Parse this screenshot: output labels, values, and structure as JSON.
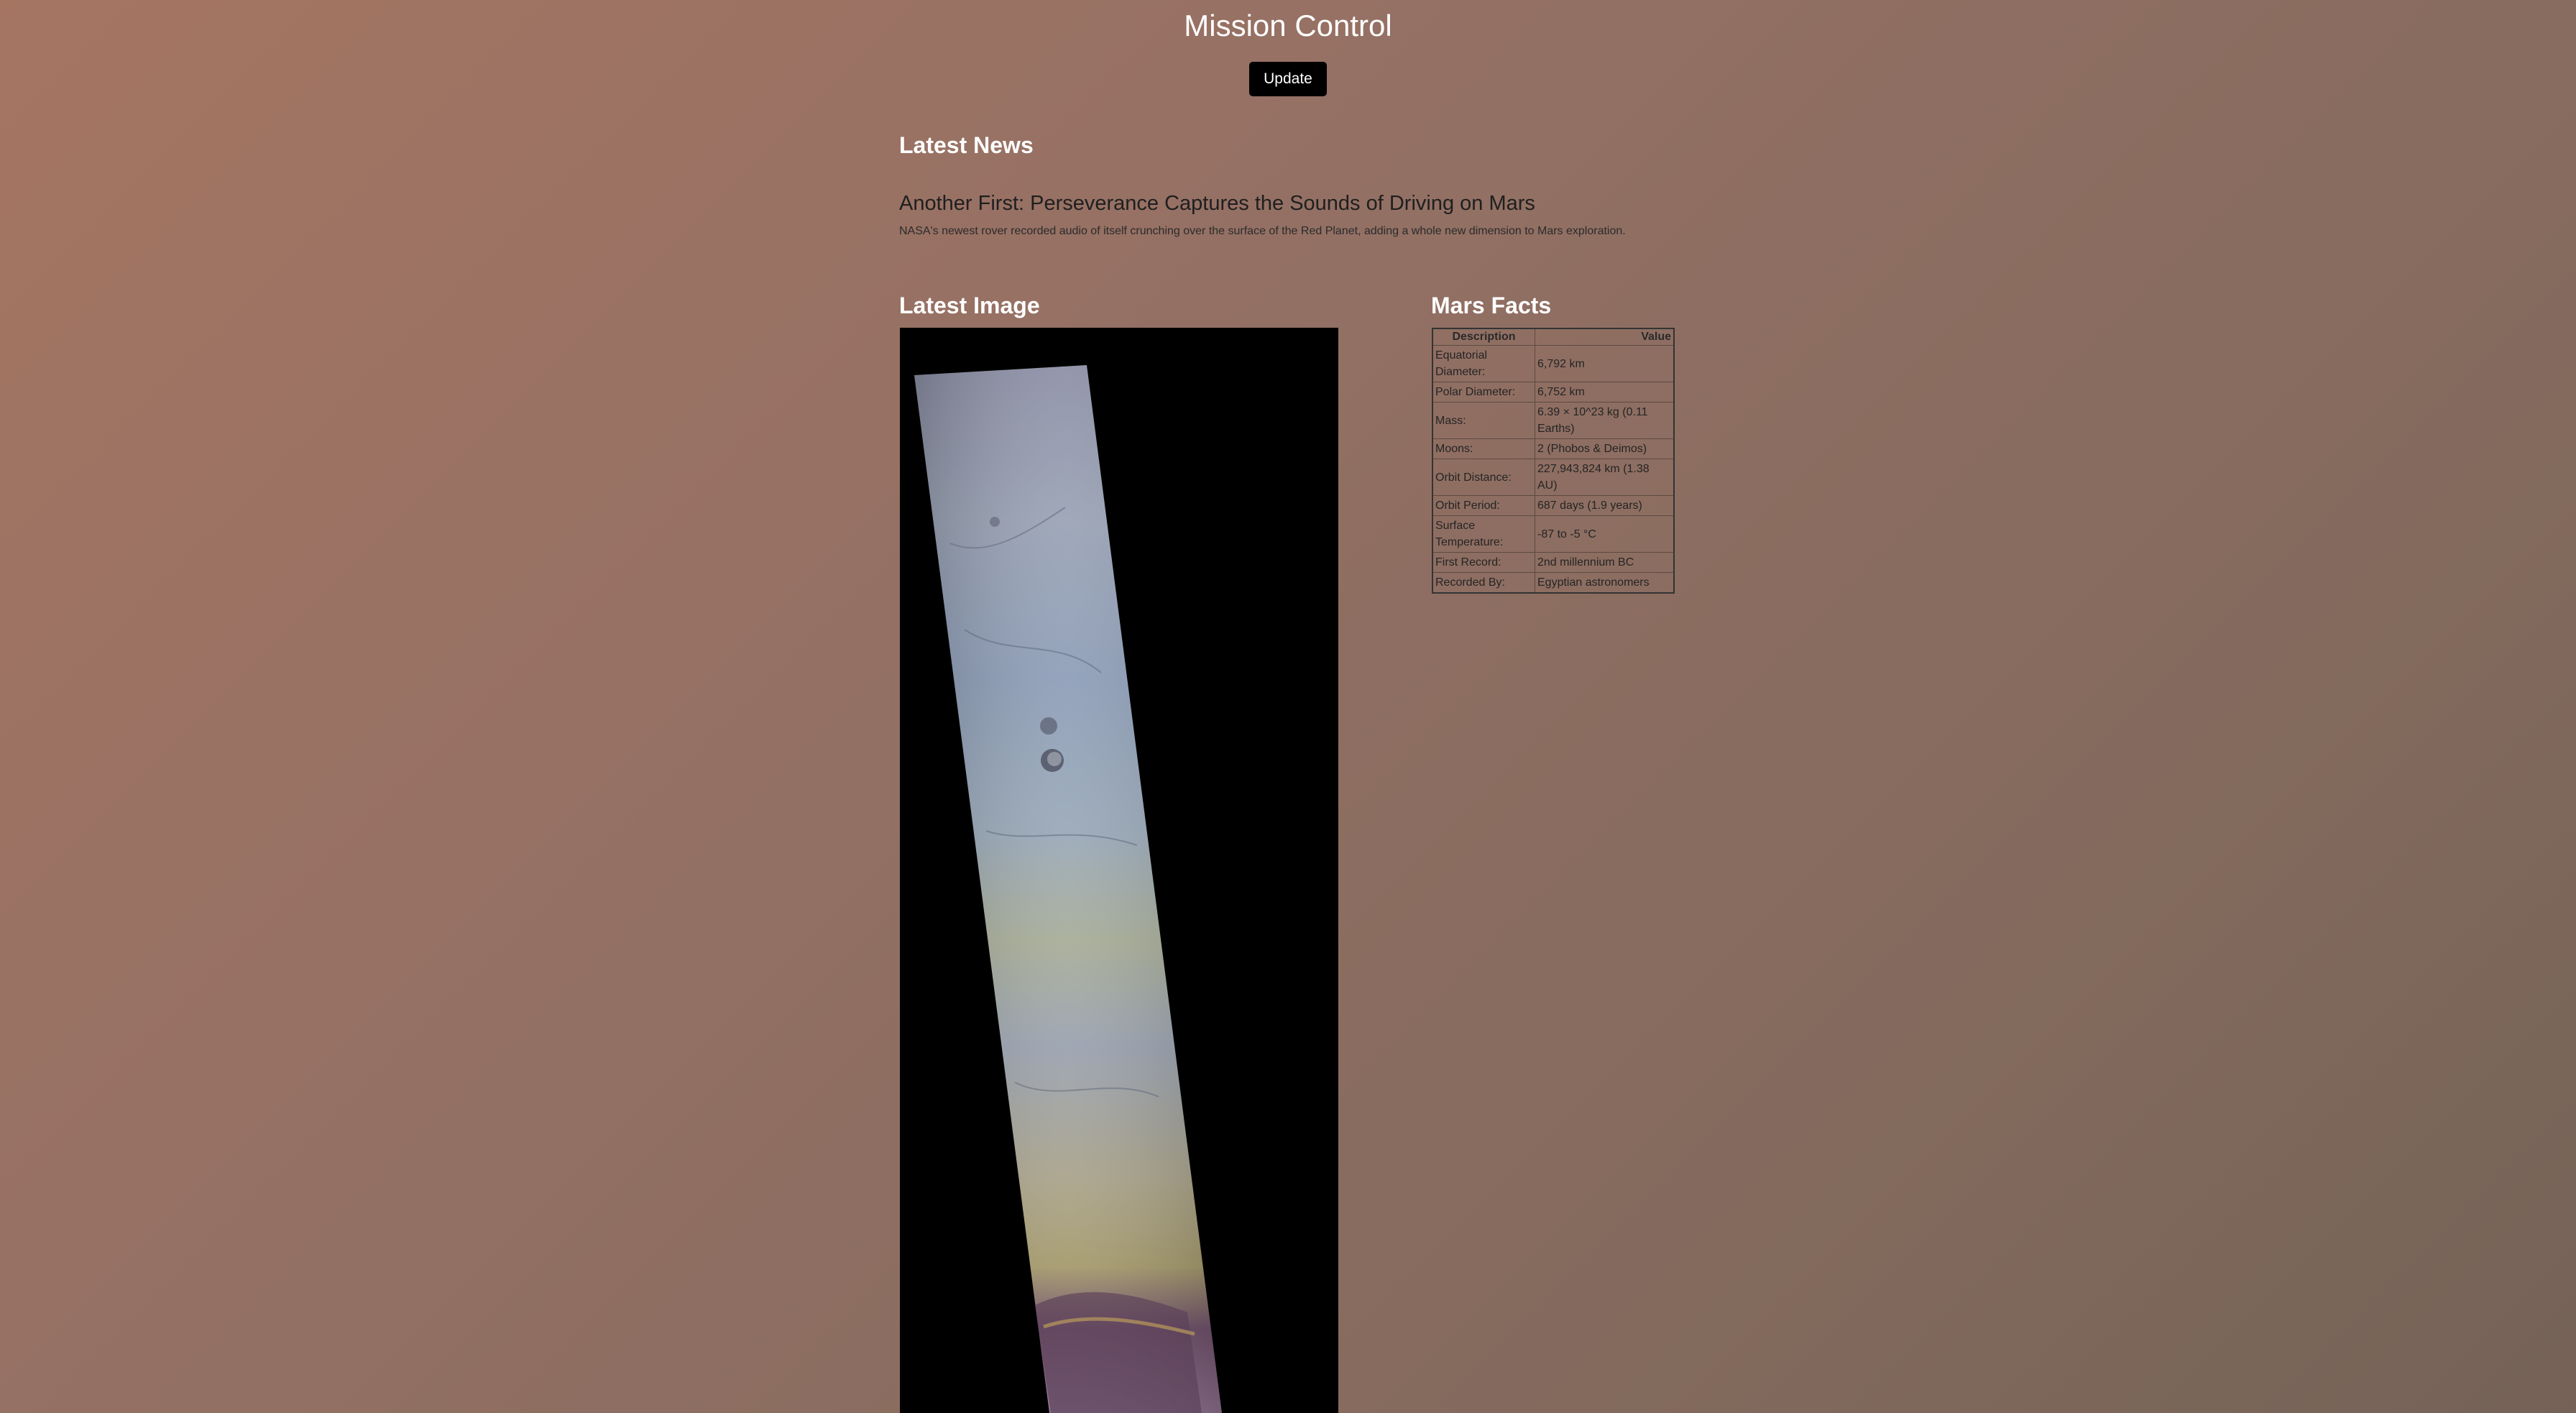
{
  "header": {
    "title": "Mission Control",
    "update_label": "Update"
  },
  "news": {
    "heading": "Latest News",
    "title": "Another First: Perseverance Captures the Sounds of Driving on Mars",
    "summary": "NASA's newest rover recorded audio of itself crunching over the surface of the Red Planet, adding a whole new dimension to Mars exploration."
  },
  "image_section": {
    "heading": "Latest Image"
  },
  "facts": {
    "heading": "Mars Facts",
    "columns": [
      "Description",
      "Value"
    ],
    "rows": [
      {
        "label": "Equatorial Diameter:",
        "value": "6,792 km"
      },
      {
        "label": "Polar Diameter:",
        "value": "6,752 km"
      },
      {
        "label": "Mass:",
        "value": "6.39 × 10^23 kg (0.11 Earths)"
      },
      {
        "label": "Moons:",
        "value": "2 (Phobos & Deimos)"
      },
      {
        "label": "Orbit Distance:",
        "value": "227,943,824 km (1.38 AU)"
      },
      {
        "label": "Orbit Period:",
        "value": "687 days (1.9 years)"
      },
      {
        "label": "Surface Temperature:",
        "value": "-87 to -5 °C"
      },
      {
        "label": "First Record:",
        "value": "2nd millennium BC"
      },
      {
        "label": "Recorded By:",
        "value": "Egyptian astronomers"
      }
    ]
  },
  "colors": {
    "background_start": "#a57562",
    "background_end": "#756257",
    "button_bg": "#000000",
    "heading_text": "#ffffff"
  }
}
